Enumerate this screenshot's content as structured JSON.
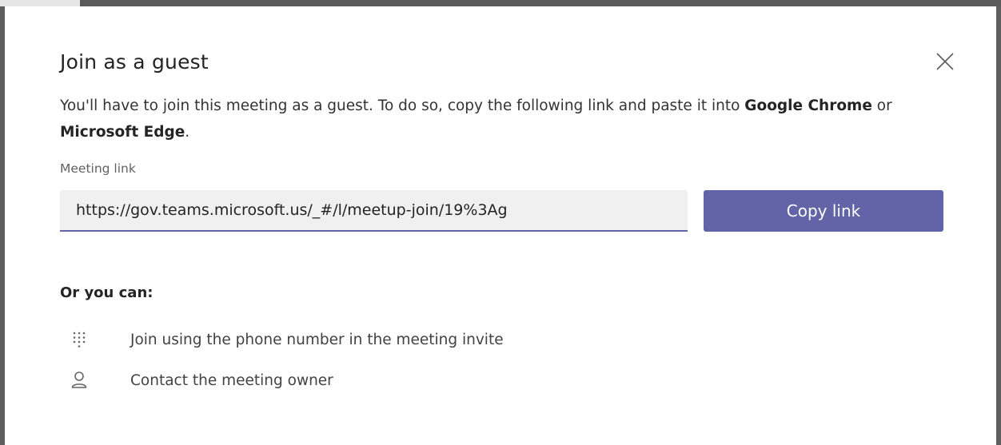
{
  "dialog": {
    "title": "Join as a guest",
    "description_pre": "You'll have to join this meeting as a guest. To do so, copy the following link and paste it into ",
    "browser_1": "Google Chrome",
    "description_mid": " or ",
    "browser_2": "Microsoft Edge",
    "description_post": ".",
    "close_icon": "close-icon"
  },
  "meeting_link": {
    "label": "Meeting link",
    "value": "https://gov.teams.microsoft.us/_#/l/meetup-join/19%3Ag"
  },
  "copy_button": {
    "label": "Copy link"
  },
  "alternatives": {
    "heading": "Or you can:",
    "items": [
      {
        "icon": "dialpad-icon",
        "label": "Join using the phone number in the meeting invite"
      },
      {
        "icon": "person-icon",
        "label": "Contact the meeting owner"
      }
    ]
  },
  "colors": {
    "accent": "#6264a7",
    "input_background": "#f0f0f0",
    "dialog_background": "#ffffff",
    "backdrop": "#5f5f5f"
  }
}
